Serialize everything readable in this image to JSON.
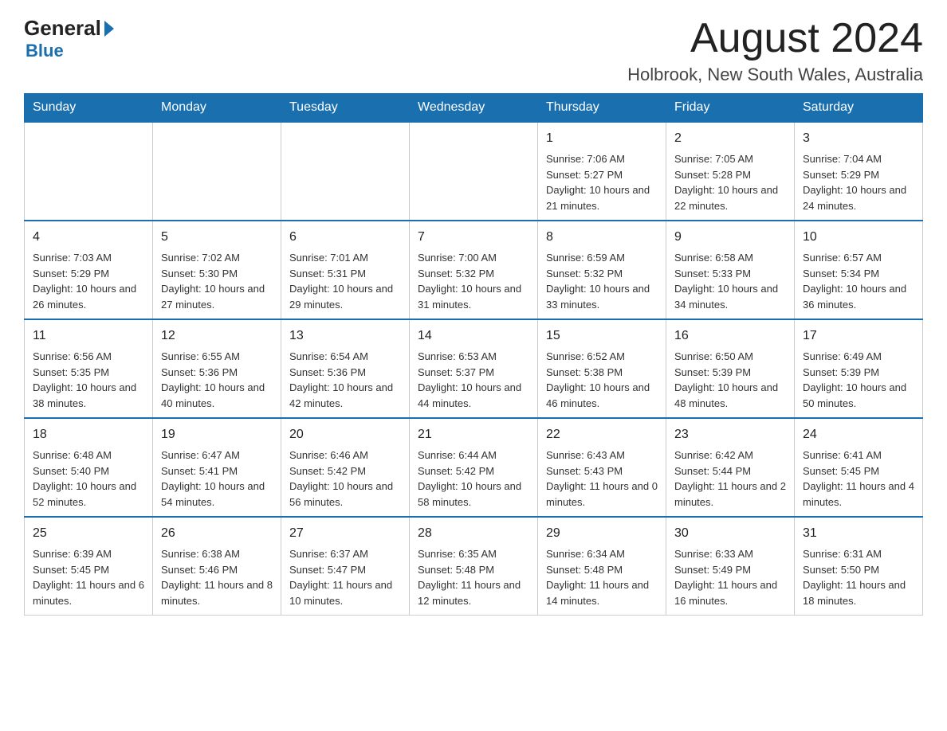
{
  "header": {
    "logo_general": "General",
    "logo_blue": "Blue",
    "month_title": "August 2024",
    "location": "Holbrook, New South Wales, Australia"
  },
  "days_of_week": [
    "Sunday",
    "Monday",
    "Tuesday",
    "Wednesday",
    "Thursday",
    "Friday",
    "Saturday"
  ],
  "weeks": [
    [
      {
        "day": "",
        "info": ""
      },
      {
        "day": "",
        "info": ""
      },
      {
        "day": "",
        "info": ""
      },
      {
        "day": "",
        "info": ""
      },
      {
        "day": "1",
        "info": "Sunrise: 7:06 AM\nSunset: 5:27 PM\nDaylight: 10 hours and 21 minutes."
      },
      {
        "day": "2",
        "info": "Sunrise: 7:05 AM\nSunset: 5:28 PM\nDaylight: 10 hours and 22 minutes."
      },
      {
        "day": "3",
        "info": "Sunrise: 7:04 AM\nSunset: 5:29 PM\nDaylight: 10 hours and 24 minutes."
      }
    ],
    [
      {
        "day": "4",
        "info": "Sunrise: 7:03 AM\nSunset: 5:29 PM\nDaylight: 10 hours and 26 minutes."
      },
      {
        "day": "5",
        "info": "Sunrise: 7:02 AM\nSunset: 5:30 PM\nDaylight: 10 hours and 27 minutes."
      },
      {
        "day": "6",
        "info": "Sunrise: 7:01 AM\nSunset: 5:31 PM\nDaylight: 10 hours and 29 minutes."
      },
      {
        "day": "7",
        "info": "Sunrise: 7:00 AM\nSunset: 5:32 PM\nDaylight: 10 hours and 31 minutes."
      },
      {
        "day": "8",
        "info": "Sunrise: 6:59 AM\nSunset: 5:32 PM\nDaylight: 10 hours and 33 minutes."
      },
      {
        "day": "9",
        "info": "Sunrise: 6:58 AM\nSunset: 5:33 PM\nDaylight: 10 hours and 34 minutes."
      },
      {
        "day": "10",
        "info": "Sunrise: 6:57 AM\nSunset: 5:34 PM\nDaylight: 10 hours and 36 minutes."
      }
    ],
    [
      {
        "day": "11",
        "info": "Sunrise: 6:56 AM\nSunset: 5:35 PM\nDaylight: 10 hours and 38 minutes."
      },
      {
        "day": "12",
        "info": "Sunrise: 6:55 AM\nSunset: 5:36 PM\nDaylight: 10 hours and 40 minutes."
      },
      {
        "day": "13",
        "info": "Sunrise: 6:54 AM\nSunset: 5:36 PM\nDaylight: 10 hours and 42 minutes."
      },
      {
        "day": "14",
        "info": "Sunrise: 6:53 AM\nSunset: 5:37 PM\nDaylight: 10 hours and 44 minutes."
      },
      {
        "day": "15",
        "info": "Sunrise: 6:52 AM\nSunset: 5:38 PM\nDaylight: 10 hours and 46 minutes."
      },
      {
        "day": "16",
        "info": "Sunrise: 6:50 AM\nSunset: 5:39 PM\nDaylight: 10 hours and 48 minutes."
      },
      {
        "day": "17",
        "info": "Sunrise: 6:49 AM\nSunset: 5:39 PM\nDaylight: 10 hours and 50 minutes."
      }
    ],
    [
      {
        "day": "18",
        "info": "Sunrise: 6:48 AM\nSunset: 5:40 PM\nDaylight: 10 hours and 52 minutes."
      },
      {
        "day": "19",
        "info": "Sunrise: 6:47 AM\nSunset: 5:41 PM\nDaylight: 10 hours and 54 minutes."
      },
      {
        "day": "20",
        "info": "Sunrise: 6:46 AM\nSunset: 5:42 PM\nDaylight: 10 hours and 56 minutes."
      },
      {
        "day": "21",
        "info": "Sunrise: 6:44 AM\nSunset: 5:42 PM\nDaylight: 10 hours and 58 minutes."
      },
      {
        "day": "22",
        "info": "Sunrise: 6:43 AM\nSunset: 5:43 PM\nDaylight: 11 hours and 0 minutes."
      },
      {
        "day": "23",
        "info": "Sunrise: 6:42 AM\nSunset: 5:44 PM\nDaylight: 11 hours and 2 minutes."
      },
      {
        "day": "24",
        "info": "Sunrise: 6:41 AM\nSunset: 5:45 PM\nDaylight: 11 hours and 4 minutes."
      }
    ],
    [
      {
        "day": "25",
        "info": "Sunrise: 6:39 AM\nSunset: 5:45 PM\nDaylight: 11 hours and 6 minutes."
      },
      {
        "day": "26",
        "info": "Sunrise: 6:38 AM\nSunset: 5:46 PM\nDaylight: 11 hours and 8 minutes."
      },
      {
        "day": "27",
        "info": "Sunrise: 6:37 AM\nSunset: 5:47 PM\nDaylight: 11 hours and 10 minutes."
      },
      {
        "day": "28",
        "info": "Sunrise: 6:35 AM\nSunset: 5:48 PM\nDaylight: 11 hours and 12 minutes."
      },
      {
        "day": "29",
        "info": "Sunrise: 6:34 AM\nSunset: 5:48 PM\nDaylight: 11 hours and 14 minutes."
      },
      {
        "day": "30",
        "info": "Sunrise: 6:33 AM\nSunset: 5:49 PM\nDaylight: 11 hours and 16 minutes."
      },
      {
        "day": "31",
        "info": "Sunrise: 6:31 AM\nSunset: 5:50 PM\nDaylight: 11 hours and 18 minutes."
      }
    ]
  ]
}
